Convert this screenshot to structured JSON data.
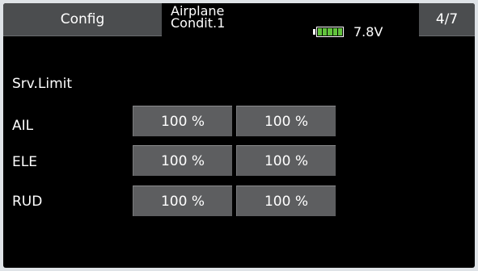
{
  "header": {
    "config_label": "Config",
    "model_type": "Airplane",
    "condition": "Condit.1",
    "voltage": "7.8V",
    "page": "4/7",
    "battery_icon": "battery-icon",
    "battery_level": 1.0,
    "battery_color": "#62c33d"
  },
  "section": {
    "title": "Srv.Limit"
  },
  "rows": [
    {
      "label": "AIL",
      "values": [
        "100 %",
        "100 %"
      ]
    },
    {
      "label": "ELE",
      "values": [
        "100 %",
        "100 %"
      ]
    },
    {
      "label": "RUD",
      "values": [
        "100 %",
        "100 %"
      ]
    }
  ],
  "colors": {
    "background": "#000000",
    "header_tab": "#4b4d4f",
    "value_button": "#5d5e60",
    "frame": "#dfe3e7"
  }
}
